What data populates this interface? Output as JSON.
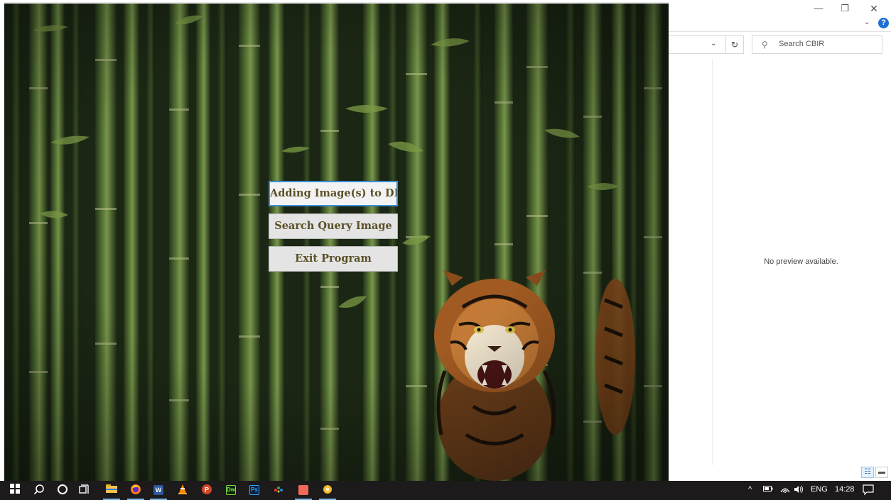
{
  "explorer": {
    "window_controls": {
      "minimize": "—",
      "restore": "❐",
      "close": "✕"
    },
    "ribbon_chevron": "⌄",
    "help": "?",
    "address_dropdown": "⌄",
    "refresh": "↻",
    "search_placeholder": "Search CBIR",
    "preview_message": "No preview available.",
    "view_buttons": {
      "details": "☷",
      "large_icons": "▬"
    }
  },
  "app": {
    "menu": {
      "add_images_label": "Adding Image(s) to DB",
      "search_query_label": "Search Query Image",
      "exit_label": "Exit Program"
    }
  },
  "taskbar": {
    "apps": [
      {
        "name": "start",
        "icon": "windows-logo-icon"
      },
      {
        "name": "search",
        "icon": "search-icon"
      },
      {
        "name": "cortana",
        "icon": "cortana-circle-icon"
      },
      {
        "name": "task-view",
        "icon": "task-view-icon"
      },
      {
        "name": "file-explorer",
        "icon": "folder-icon"
      },
      {
        "name": "firefox",
        "icon": "firefox-icon"
      },
      {
        "name": "word",
        "icon": "word-icon"
      },
      {
        "name": "vlc",
        "icon": "vlc-cone-icon"
      },
      {
        "name": "powerpoint-red",
        "icon": "red-circle-app-icon"
      },
      {
        "name": "dreamweaver",
        "icon": "dreamweaver-icon"
      },
      {
        "name": "photoshop",
        "icon": "photoshop-icon"
      },
      {
        "name": "paint",
        "icon": "palette-icon"
      },
      {
        "name": "pink-app",
        "icon": "pink-app-icon"
      },
      {
        "name": "python-app",
        "icon": "yellow-app-icon"
      }
    ],
    "dreamweaver_label": "Dw",
    "photoshop_label": "Ps",
    "word_label": "W",
    "tray": {
      "chevron": "^",
      "language": "ENG",
      "time": "14:28"
    }
  },
  "colors": {
    "button_text": "#5c5028",
    "button_focus_border": "#3c8fd6",
    "taskbar_bg": "#1c1a1a",
    "help_blue": "#1f6fd1"
  }
}
